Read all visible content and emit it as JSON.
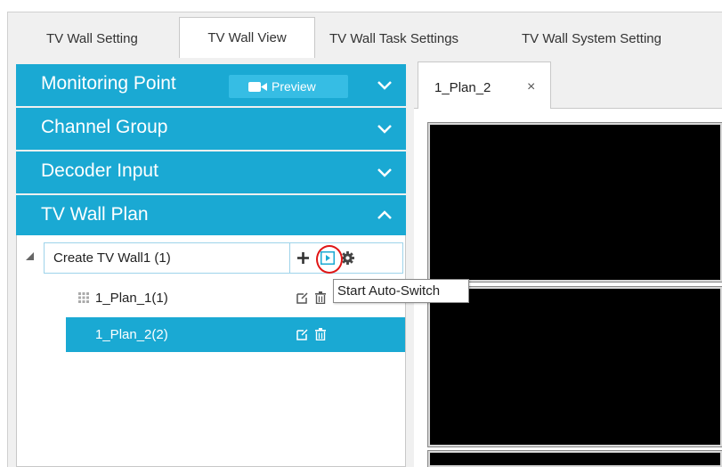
{
  "tabs": [
    {
      "label": "TV Wall Setting"
    },
    {
      "label": "TV Wall View"
    },
    {
      "label": "TV Wall Task Settings"
    },
    {
      "label": "TV Wall System Setting"
    }
  ],
  "accordion": {
    "monitoring_point": {
      "label": "Monitoring Point",
      "preview_label": "Preview"
    },
    "channel_group": {
      "label": "Channel Group"
    },
    "decoder_input": {
      "label": "Decoder Input"
    },
    "tv_wall_plan": {
      "label": "TV Wall Plan"
    }
  },
  "tree": {
    "root_label": "Create TV Wall1 (1)",
    "plans": [
      {
        "label": "1_Plan_1(1)"
      },
      {
        "label": "1_Plan_2(2)"
      }
    ]
  },
  "tooltip": "Start Auto-Switch",
  "plan_tab": {
    "label": "1_Plan_2",
    "close": "×"
  },
  "colors": {
    "accent": "#1aa9d3",
    "highlight": "#e01616",
    "screen": "#000000"
  }
}
